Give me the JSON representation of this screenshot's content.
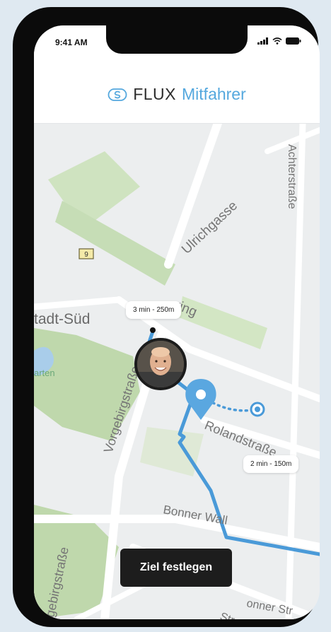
{
  "status": {
    "time": "9:41 AM",
    "icons": [
      "signal-icon",
      "wifi-icon",
      "battery-icon"
    ]
  },
  "header": {
    "brand": "FLUX",
    "subtitle": "Mitfahrer",
    "logo_icon": "flux-logo-icon"
  },
  "map": {
    "streets": {
      "ulrichgasse": "Ulrichgasse",
      "achterstrasse": "Achterstraße",
      "ring": "ring",
      "vorgebirgstrasse_top": "Vorgebirgstraße",
      "vorgebirgstrasse_bottom": "gebirgstraße",
      "rolandstrasse": "Rolandstraße",
      "bonner_wall": "Bonner Wall",
      "bonner_strasse_1": "onner Str",
      "bonner_strasse_2": "Straße",
      "district": "tadt-Süd",
      "park": "arten",
      "route_number": "9"
    },
    "driver_eta": "3 min - 250m",
    "destination_eta": "2 min - 150m"
  },
  "actions": {
    "set_destination": "Ziel festlegen"
  },
  "colors": {
    "accent": "#55a8de",
    "route": "#4a9ad8",
    "button_bg": "#1d1d1d"
  }
}
